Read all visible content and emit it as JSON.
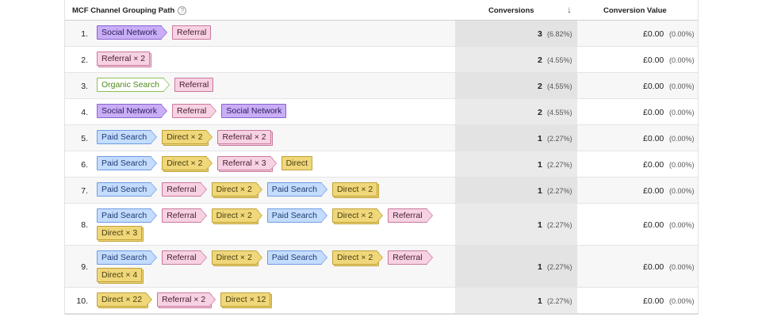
{
  "header": {
    "path_label": "MCF Channel Grouping Path",
    "help": "?",
    "conversions_label": "Conversions",
    "sort_icon": "↓",
    "value_label": "Conversion Value"
  },
  "rows": [
    {
      "index": "1.",
      "conversions": "3",
      "conv_pct": "(6.82%)",
      "value": "£0.00",
      "value_pct": "(0.00%)",
      "steps": [
        {
          "label": "Social Network",
          "type": "social"
        },
        {
          "label": "Referral",
          "type": "referral"
        }
      ]
    },
    {
      "index": "2.",
      "conversions": "2",
      "conv_pct": "(4.55%)",
      "value": "£0.00",
      "value_pct": "(0.00%)",
      "steps": [
        {
          "label": "Referral × 2",
          "type": "referral"
        }
      ]
    },
    {
      "index": "3.",
      "conversions": "2",
      "conv_pct": "(4.55%)",
      "value": "£0.00",
      "value_pct": "(0.00%)",
      "steps": [
        {
          "label": "Organic Search",
          "type": "organic"
        },
        {
          "label": "Referral",
          "type": "referral"
        }
      ]
    },
    {
      "index": "4.",
      "conversions": "2",
      "conv_pct": "(4.55%)",
      "value": "£0.00",
      "value_pct": "(0.00%)",
      "steps": [
        {
          "label": "Social Network",
          "type": "social"
        },
        {
          "label": "Referral",
          "type": "referral"
        },
        {
          "label": "Social Network",
          "type": "social"
        }
      ]
    },
    {
      "index": "5.",
      "conversions": "1",
      "conv_pct": "(2.27%)",
      "value": "£0.00",
      "value_pct": "(0.00%)",
      "steps": [
        {
          "label": "Paid Search",
          "type": "paid"
        },
        {
          "label": "Direct × 2",
          "type": "direct"
        },
        {
          "label": "Referral × 2",
          "type": "referral"
        }
      ]
    },
    {
      "index": "6.",
      "conversions": "1",
      "conv_pct": "(2.27%)",
      "value": "£0.00",
      "value_pct": "(0.00%)",
      "steps": [
        {
          "label": "Paid Search",
          "type": "paid"
        },
        {
          "label": "Direct × 2",
          "type": "direct"
        },
        {
          "label": "Referral × 3",
          "type": "referral"
        },
        {
          "label": "Direct",
          "type": "direct"
        }
      ]
    },
    {
      "index": "7.",
      "conversions": "1",
      "conv_pct": "(2.27%)",
      "value": "£0.00",
      "value_pct": "(0.00%)",
      "steps": [
        {
          "label": "Paid Search",
          "type": "paid"
        },
        {
          "label": "Referral",
          "type": "referral"
        },
        {
          "label": "Direct × 2",
          "type": "direct"
        },
        {
          "label": "Paid Search",
          "type": "paid"
        },
        {
          "label": "Direct × 2",
          "type": "direct"
        }
      ]
    },
    {
      "index": "8.",
      "conversions": "1",
      "conv_pct": "(2.27%)",
      "value": "£0.00",
      "value_pct": "(0.00%)",
      "steps": [
        {
          "label": "Paid Search",
          "type": "paid"
        },
        {
          "label": "Referral",
          "type": "referral"
        },
        {
          "label": "Direct × 2",
          "type": "direct"
        },
        {
          "label": "Paid Search",
          "type": "paid"
        },
        {
          "label": "Direct × 2",
          "type": "direct"
        },
        {
          "label": "Referral",
          "type": "referral"
        },
        {
          "label": "Direct × 3",
          "type": "direct"
        }
      ]
    },
    {
      "index": "9.",
      "conversions": "1",
      "conv_pct": "(2.27%)",
      "value": "£0.00",
      "value_pct": "(0.00%)",
      "steps": [
        {
          "label": "Paid Search",
          "type": "paid"
        },
        {
          "label": "Referral",
          "type": "referral"
        },
        {
          "label": "Direct × 2",
          "type": "direct"
        },
        {
          "label": "Paid Search",
          "type": "paid"
        },
        {
          "label": "Direct × 2",
          "type": "direct"
        },
        {
          "label": "Referral",
          "type": "referral"
        },
        {
          "label": "Direct × 4",
          "type": "direct"
        }
      ]
    },
    {
      "index": "10.",
      "conversions": "1",
      "conv_pct": "(2.27%)",
      "value": "£0.00",
      "value_pct": "(0.00%)",
      "steps": [
        {
          "label": "Direct × 22",
          "type": "direct"
        },
        {
          "label": "Referral × 2",
          "type": "referral"
        },
        {
          "label": "Direct × 12",
          "type": "direct"
        }
      ]
    }
  ],
  "colors": {
    "social": "#c9aef7",
    "referral": "#f7d2e3",
    "organic": "#ffffff",
    "paid": "#c4dcfd",
    "direct": "#efd77a"
  }
}
